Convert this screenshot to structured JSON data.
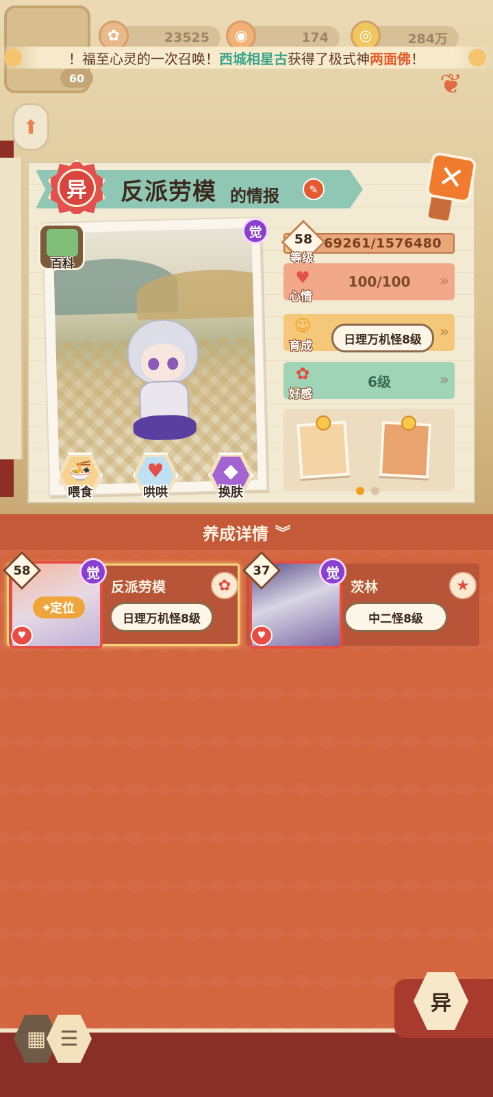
{
  "resources": {
    "items": [
      {
        "icon": "blossom-icon",
        "value": "23525"
      },
      {
        "icon": "coin-icon",
        "value": "174"
      },
      {
        "icon": "gold-icon",
        "value": "284万"
      }
    ],
    "player_level": "60"
  },
  "announcement": {
    "prefix": "！福至心灵的一次召唤！",
    "player": "西城相星古",
    "middle": "获得了极式神",
    "reward": "两面佛",
    "suffix": "！"
  },
  "panel": {
    "badge": "异",
    "name": "反派劳模",
    "suffix": "的情报",
    "baike_label": "百科",
    "awake_badge": "觉"
  },
  "stats": {
    "level": {
      "label": "等级",
      "value": "58",
      "exp_text": "69261/1576480",
      "exp_fraction": 0.044
    },
    "mood": {
      "label": "心情",
      "value": "100/100"
    },
    "growth": {
      "label": "育成",
      "value": "日理万机怪8级"
    },
    "affinity": {
      "label": "好感",
      "value": "6级"
    }
  },
  "actions": {
    "feed": "喂食",
    "comfort": "哄哄",
    "skin": "换肤"
  },
  "item_pages": {
    "count": 2,
    "active": 0
  },
  "details_bar": {
    "label": "养成详情"
  },
  "cards": [
    {
      "level": "58",
      "name": "反派劳模",
      "tag": "日理万机怪8级",
      "awake": "觉",
      "locate": "定位",
      "selected": true
    },
    {
      "level": "37",
      "name": "茨林",
      "tag": "中二怪8级",
      "awake": "觉",
      "selected": false
    }
  ],
  "bottom_button": {
    "label": "异"
  },
  "colors": {
    "mood": "#f2a98a",
    "growth": "#f4c878",
    "affinity": "#9fd4b6",
    "accent": "#e2514b"
  }
}
